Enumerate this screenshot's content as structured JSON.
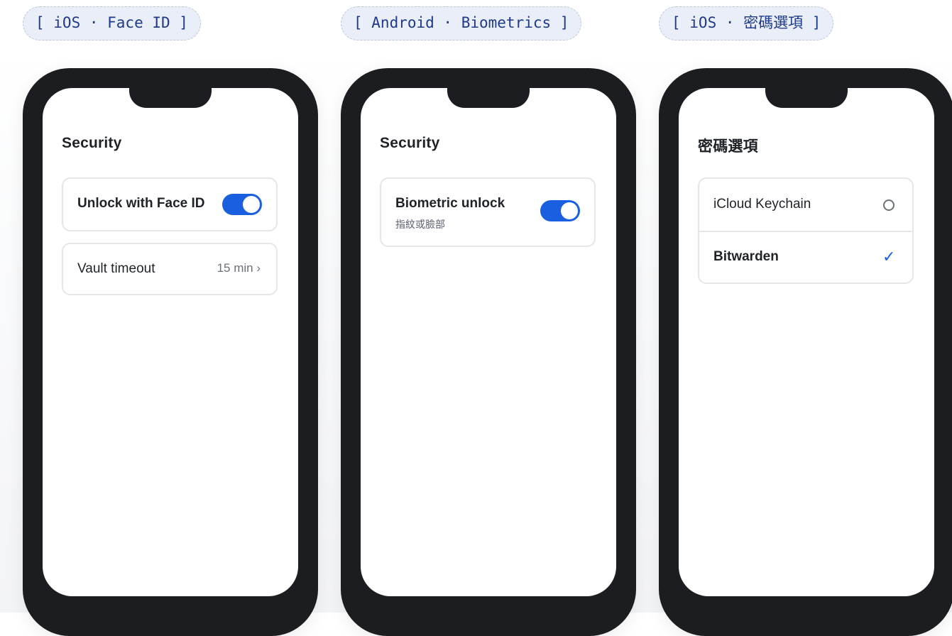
{
  "labels": {
    "ios_face_id": "[ iOS · Face ID ]",
    "android_biometrics": "[ Android · Biometrics ]",
    "ios_password_options": "[ iOS · 密碼選項 ]"
  },
  "phones": [
    {
      "title": "Security",
      "rows": [
        {
          "label": "Unlock with Face ID",
          "toggle": true
        },
        {
          "label": "Vault timeout",
          "value": "15 min ›"
        }
      ]
    },
    {
      "title": "Security",
      "rows": [
        {
          "label": "Biometric unlock",
          "sublabel": "指紋或臉部",
          "toggle": true
        }
      ]
    },
    {
      "title": "密碼選項",
      "rows": [
        {
          "label": "iCloud Keychain",
          "selected": false
        },
        {
          "label": "Bitwarden",
          "selected": true
        }
      ]
    }
  ],
  "colors": {
    "accent": "#1a5fe0",
    "phone_frame": "#1c1d21",
    "pill_bg": "#e9eef8",
    "pill_text": "#1e3a8a"
  },
  "icons": {
    "unselected": "radio-unselected-icon",
    "selected": "checkmark-icon"
  }
}
